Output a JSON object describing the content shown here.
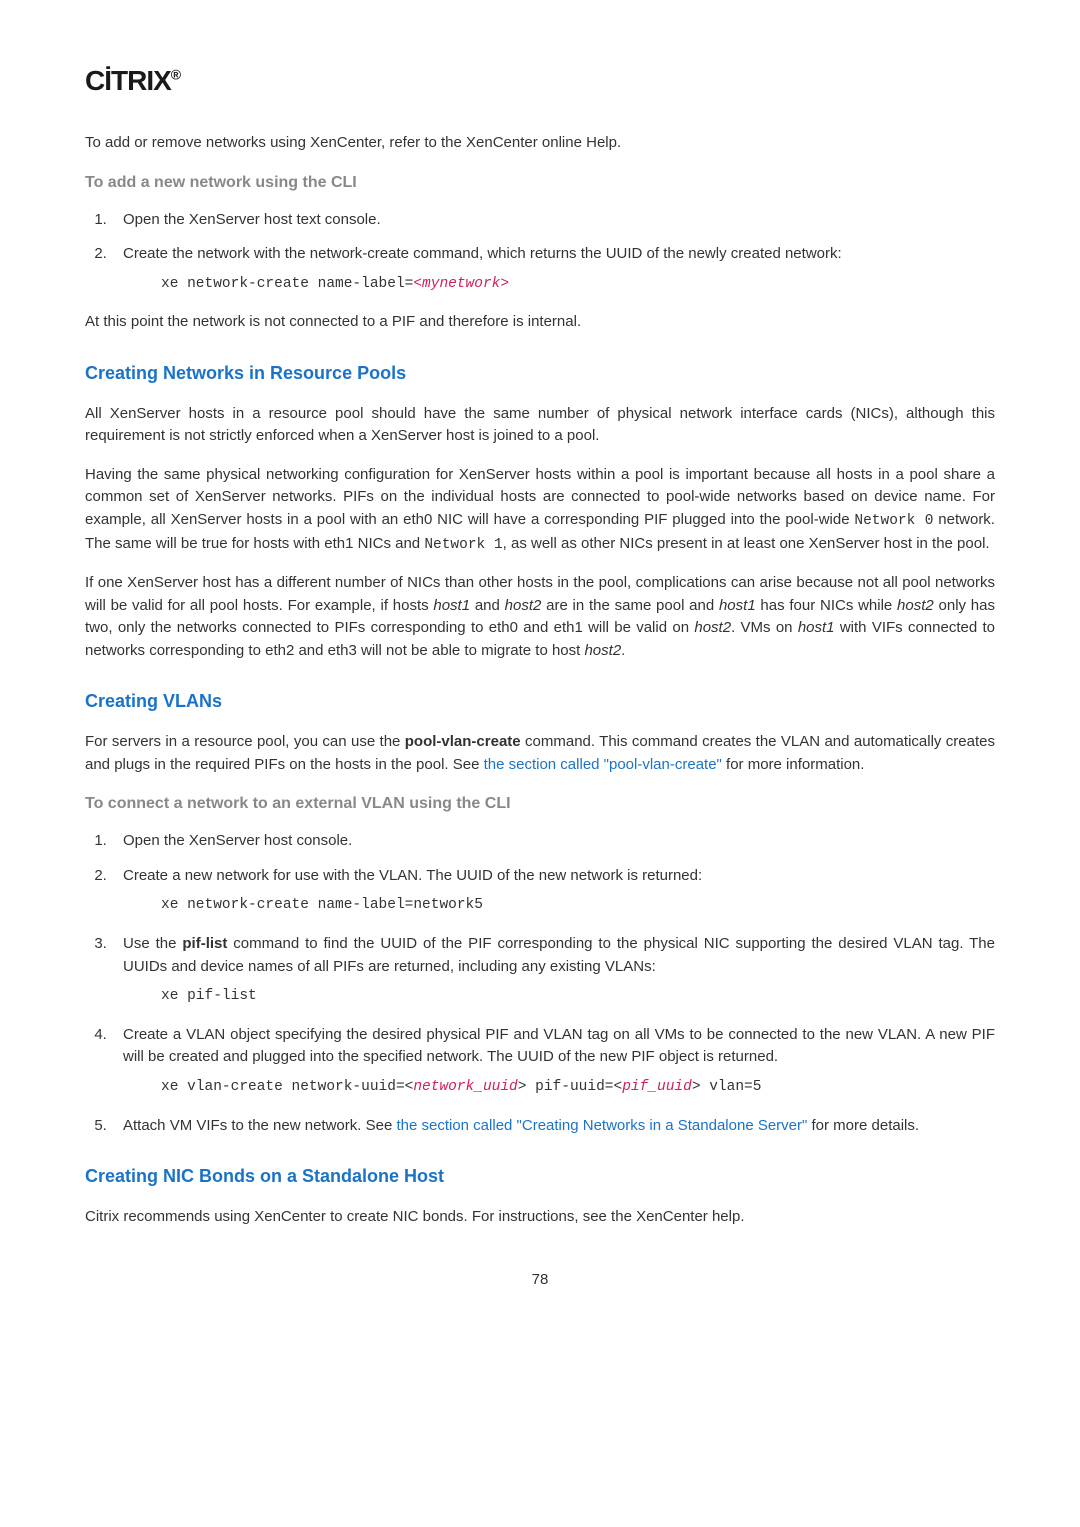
{
  "logo": "CİTRIX",
  "intro": "To add or remove networks using XenCenter, refer to the XenCenter online Help.",
  "sub1_heading": "To add a new network using the CLI",
  "sub1_item1": "Open the XenServer host text console.",
  "sub1_item2": "Create the network with the network-create command, which returns the UUID of the newly created network:",
  "cmd1_prefix": "xe network-create name-label=",
  "cmd1_arg": "<mynetwork>",
  "sub1_after": "At this point the network is not connected to a PIF and therefore is internal.",
  "sec1_heading": "Creating Networks in Resource Pools",
  "sec1_p1": "All XenServer hosts in a resource pool should have the same number of physical network interface cards (NICs), although this requirement is not strictly enforced when a XenServer host is joined to a pool.",
  "sec1_p2_a": "Having the same physical networking configuration for XenServer hosts within a pool is important because all hosts in a pool share a common set of XenServer networks. PIFs on the individual hosts are connected to pool-wide networks based on device name. For example, all XenServer hosts in a pool with an eth0 NIC will have a corresponding PIF plugged into the pool-wide ",
  "sec1_p2_code1": "Network 0",
  "sec1_p2_b": " network. The same will be true for hosts with eth1 NICs and ",
  "sec1_p2_code2": "Network 1",
  "sec1_p2_c": ", as well as other NICs present in at least one XenServer host in the pool.",
  "sec1_p3_a": "If one XenServer host has a different number of NICs than other hosts in the pool, complications can arise because not all pool networks will be valid for all pool hosts. For example, if hosts ",
  "sec1_p3_em1": "host1",
  "sec1_p3_b": " and ",
  "sec1_p3_em2": "host2",
  "sec1_p3_c": " are in the same pool and ",
  "sec1_p3_em3": "host1",
  "sec1_p3_d": " has four NICs while ",
  "sec1_p3_em4": "host2",
  "sec1_p3_e": " only has two, only the networks connected to PIFs corresponding to eth0 and eth1 will be valid on ",
  "sec1_p3_em5": "host2",
  "sec1_p3_f": ". VMs on ",
  "sec1_p3_em6": "host1",
  "sec1_p3_g": " with VIFs connected to networks corresponding to eth2 and eth3 will not be able to migrate to host ",
  "sec1_p3_em7": "host2",
  "sec1_p3_h": ".",
  "sec2_heading": "Creating VLANs",
  "sec2_p1_a": "For servers in a resource pool, you can use the ",
  "sec2_p1_bold": "pool-vlan-create",
  "sec2_p1_b": " command. This command creates the VLAN and automatically creates and plugs in the required PIFs on the hosts in the pool. See ",
  "sec2_p1_link": "the section called \"pool-vlan-create\"",
  "sec2_p1_c": " for more information.",
  "sub2_heading": "To connect a network to an external VLAN using the CLI",
  "s2_item1": "Open the XenServer host console.",
  "s2_item2": "Create a new network for use with the VLAN. The UUID of the new network is returned:",
  "cmd2": "xe network-create name-label=network5",
  "s2_item3_a": "Use the ",
  "s2_item3_bold": "pif-list",
  "s2_item3_b": " command to find the UUID of the PIF corresponding to the physical NIC supporting the desired VLAN tag. The UUIDs and device names of all PIFs are returned, including any existing VLANs:",
  "cmd3": "xe pif-list",
  "s2_item4": "Create a VLAN object specifying the desired physical PIF and VLAN tag on all VMs to be connected to the new VLAN. A new PIF will be created and plugged into the specified network. The UUID of the new PIF object is returned.",
  "cmd4_a": "xe vlan-create network-uuid=<",
  "cmd4_arg1": "network_uuid",
  "cmd4_b": "> pif-uuid=<",
  "cmd4_arg2": "pif_uuid",
  "cmd4_c": "> vlan=5",
  "s2_item5_a": "Attach VM VIFs to the new network. See ",
  "s2_item5_link": "the section called \"Creating Networks in a Standalone Server\"",
  "s2_item5_b": " for more details.",
  "sec3_heading": "Creating NIC Bonds on a Standalone Host",
  "sec3_p1": "Citrix recommends using XenCenter to create NIC bonds. For instructions, see the XenCenter help.",
  "page_num": "78"
}
